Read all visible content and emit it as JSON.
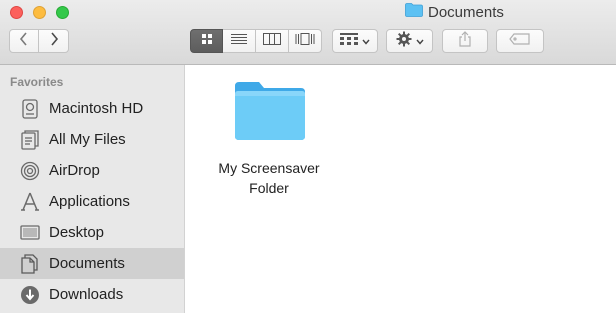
{
  "window": {
    "title": "Documents",
    "title_icon": "folder-icon"
  },
  "toolbar": {
    "back_icon": "chevron-left-icon",
    "forward_icon": "chevron-right-icon",
    "view_modes": [
      "icon-view",
      "list-view",
      "column-view",
      "cover-flow-view"
    ],
    "active_view_index": 0,
    "arrange_icon": "grid-arrange-icon",
    "action_icon": "gear-icon",
    "share_icon": "share-icon",
    "tag_icon": "tag-icon"
  },
  "sidebar": {
    "heading": "Favorites",
    "items": [
      {
        "label": "Macintosh HD",
        "icon": "hard-drive-icon",
        "selected": false
      },
      {
        "label": "All My Files",
        "icon": "all-files-icon",
        "selected": false
      },
      {
        "label": "AirDrop",
        "icon": "airdrop-icon",
        "selected": false
      },
      {
        "label": "Applications",
        "icon": "applications-icon",
        "selected": false
      },
      {
        "label": "Desktop",
        "icon": "desktop-icon",
        "selected": false
      },
      {
        "label": "Documents",
        "icon": "documents-icon",
        "selected": true
      },
      {
        "label": "Downloads",
        "icon": "downloads-icon",
        "selected": false
      }
    ]
  },
  "content": {
    "items": [
      {
        "name": "My Screensaver\nFolder",
        "icon": "folder-icon"
      }
    ]
  },
  "colors": {
    "folder": "#5cc1f3",
    "sidebar_bg": "#e8e8e8",
    "selected_bg": "#d0d0d0"
  }
}
